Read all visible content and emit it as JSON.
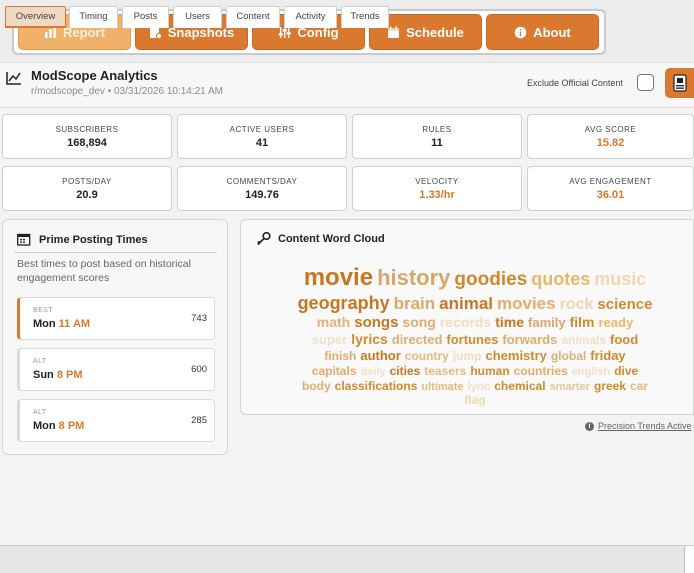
{
  "nav": [
    {
      "label": "Report",
      "icon": "report-icon",
      "active": true
    },
    {
      "label": "Snapshots",
      "icon": "snapshot-icon"
    },
    {
      "label": "Config",
      "icon": "sliders-icon"
    },
    {
      "label": "Schedule",
      "icon": "calendar-icon"
    },
    {
      "label": "About",
      "icon": "info-icon"
    }
  ],
  "header": {
    "title": "ModScope Analytics",
    "subtitle": "r/modscope_dev • 03/31/2026 10:14:21 AM",
    "exclude_label": "Exclude Official Content",
    "exclude_checked": false,
    "export_icon": "export-icon"
  },
  "stats": [
    {
      "label": "SUBSCRIBERS",
      "value": "168,894",
      "accent": false
    },
    {
      "label": "ACTIVE USERS",
      "value": "41",
      "accent": false
    },
    {
      "label": "RULES",
      "value": "11",
      "accent": false
    },
    {
      "label": "AVG SCORE",
      "value": "15.82",
      "accent": true
    },
    {
      "label": "POSTS/DAY",
      "value": "20.9",
      "accent": false
    },
    {
      "label": "COMMENTS/DAY",
      "value": "149.76",
      "accent": false
    },
    {
      "label": "VELOCITY",
      "value": "1.33/hr",
      "accent": true
    },
    {
      "label": "AVG ENGAGEMENT",
      "value": "36.01",
      "accent": true
    }
  ],
  "prime": {
    "title": "Prime Posting Times",
    "description": "Best times to post based on historical engagement scores",
    "slots": [
      {
        "kind": "BEST",
        "day": "Mon",
        "time": "11 AM",
        "score": "743"
      },
      {
        "kind": "ALT",
        "day": "Sun",
        "time": "8 PM",
        "score": "600"
      },
      {
        "kind": "ALT",
        "day": "Mon",
        "time": "8 PM",
        "score": "285"
      }
    ]
  },
  "cloud": {
    "title": "Content Word Cloud",
    "lines": [
      [
        [
          "movie",
          24,
          "#c8761f"
        ],
        [
          "history",
          22,
          "#d7a669"
        ],
        [
          "goodies",
          19,
          "#d08a2e"
        ],
        [
          "quotes",
          18,
          "#e8b865"
        ],
        [
          "music",
          18,
          "#f0d7b0"
        ]
      ],
      [
        [
          "geography",
          18,
          "#c8761f"
        ],
        [
          "brain",
          17,
          "#dca86a"
        ],
        [
          "animal",
          17,
          "#c8761f"
        ],
        [
          "movies",
          17,
          "#e4ad6d"
        ],
        [
          "rock",
          16,
          "#eed6b3"
        ],
        [
          "science",
          15,
          "#d08a2e"
        ]
      ],
      [
        [
          "math",
          14,
          "#e0b17c"
        ],
        [
          "songs",
          15,
          "#c8761f"
        ],
        [
          "song",
          14,
          "#e2ab6c"
        ],
        [
          "records",
          14,
          "#f1dcbd"
        ],
        [
          "time",
          14,
          "#c8761f"
        ],
        [
          "family",
          13,
          "#d9a46b"
        ],
        [
          "film",
          14,
          "#d08a2e"
        ],
        [
          "ready",
          13,
          "#e8b865"
        ]
      ],
      [
        [
          "super",
          13,
          "#f2dfc6"
        ],
        [
          "lyrics",
          14,
          "#d08a2e"
        ],
        [
          "directed",
          13,
          "#dfae76"
        ],
        [
          "fortunes",
          13,
          "#d08a2e"
        ],
        [
          "forwards",
          13,
          "#e2ab6c"
        ],
        [
          "animals",
          12,
          "#f2dfc6"
        ],
        [
          "food",
          13,
          "#d08a2e"
        ]
      ],
      [
        [
          "finish",
          12,
          "#e2ab6c"
        ],
        [
          "author",
          13,
          "#c8761f"
        ],
        [
          "country",
          12,
          "#e6b980"
        ],
        [
          "jump",
          12,
          "#f1dcbd"
        ],
        [
          "chemistry",
          13,
          "#d08a2e"
        ],
        [
          "global",
          12,
          "#dfae76"
        ],
        [
          "friday",
          13,
          "#d08a2e"
        ]
      ],
      [
        [
          "capitals",
          12,
          "#e2ab6c"
        ],
        [
          "daily",
          11,
          "#f2dfc6"
        ],
        [
          "cities",
          12,
          "#c8761f"
        ],
        [
          "teasers",
          12,
          "#e6b980"
        ],
        [
          "human",
          12,
          "#d08a2e"
        ],
        [
          "countries",
          12,
          "#e2ab6c"
        ],
        [
          "english",
          11,
          "#f2dfc6"
        ],
        [
          "dive",
          12,
          "#d08a2e"
        ]
      ],
      [
        [
          "body",
          12,
          "#dfae76"
        ],
        [
          "classifications",
          12,
          "#d08a2e"
        ],
        [
          "ultimate",
          11,
          "#e6b980"
        ],
        [
          "lyric",
          11,
          "#f2dfc6"
        ],
        [
          "chemical",
          12,
          "#d08a2e"
        ],
        [
          "smarter",
          11,
          "#e6c59a"
        ],
        [
          "greek",
          12,
          "#d08a2e"
        ],
        [
          "car",
          12,
          "#e6b980"
        ]
      ],
      [
        [
          "flag",
          12,
          "#f0d7b0"
        ]
      ]
    ]
  },
  "trends_link": "Precision Trends Active",
  "tabs": [
    {
      "label": "Overview",
      "active": true
    },
    {
      "label": "Timing"
    },
    {
      "label": "Posts"
    },
    {
      "label": "Users"
    },
    {
      "label": "Content"
    },
    {
      "label": "Activity"
    },
    {
      "label": "Trends"
    }
  ],
  "colors": {
    "accent": "#d9782e",
    "accent_light": "#f0b16b"
  }
}
